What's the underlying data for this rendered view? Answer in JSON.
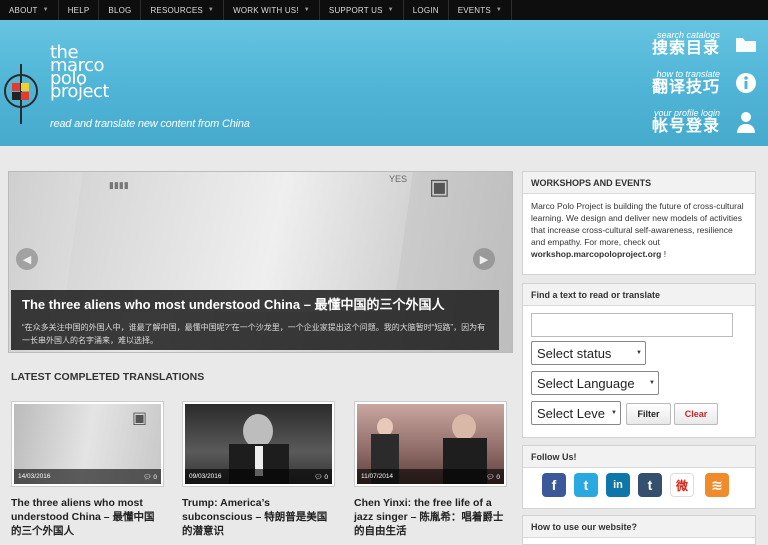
{
  "nav": {
    "items": [
      {
        "label": "ABOUT",
        "caret": true
      },
      {
        "label": "HELP",
        "caret": false
      },
      {
        "label": "BLOG",
        "caret": false
      },
      {
        "label": "RESOURCES",
        "caret": true
      },
      {
        "label": "WORK WITH US!",
        "caret": true
      },
      {
        "label": "SUPPORT US",
        "caret": true
      },
      {
        "label": "LOGIN",
        "caret": false
      },
      {
        "label": "EVENTS",
        "caret": true
      }
    ]
  },
  "banner": {
    "logo_line1": "the",
    "logo_line2": "marco",
    "logo_line3": "polo",
    "logo_line4": "project",
    "tagline": "read and translate new content from China",
    "tools": [
      {
        "en": "search catalogs",
        "zh": "搜索目录",
        "icon": "folder-icon"
      },
      {
        "en": "how to translate",
        "zh": "翻译技巧",
        "icon": "info-icon"
      },
      {
        "en": "your profile login",
        "zh": "帐号登录",
        "icon": "user-icon"
      }
    ]
  },
  "slider": {
    "title": "The three aliens who most understood China – 最懂中国的三个外国人",
    "summary": "“在众多关注中国的外国人中，谁最了解中国，最懂中国呢?”在一个沙龙里，一个企业家提出这个问题。我的大脑暂时“短路”，因为有一长串外国人的名字涌来，难以选择。"
  },
  "translations": {
    "heading": "LATEST COMPLETED TRANSLATIONS",
    "cards": [
      {
        "date": "14/03/2016",
        "comments": "0",
        "title": "The three aliens who most understood China – 最懂中国的三个外国人"
      },
      {
        "date": "09/03/2016",
        "comments": "0",
        "title": "Trump: America’s subconscious – 特朗普是美国的潜意识"
      },
      {
        "date": "11/07/2014",
        "comments": "0",
        "title": "Chen Yinxi: the free life of a jazz singer – 陈胤希：唱着爵士的自由生活"
      }
    ]
  },
  "sidebar": {
    "workshops_heading": "WORKSHOPS AND EVENTS",
    "workshops_text": "Marco Polo Project is building the future of cross-cultural learning. We design and deliver new models of activities that increase cross-cultural self-awareness, resilience and empathy. For more, check out ",
    "workshops_link": "workshop.marcopoloproject.org",
    "workshops_end": " !",
    "find_heading": "Find a text to read or translate",
    "search_value": "",
    "status_select": "Select status",
    "language_select": "Select Language",
    "level_select": "Select Leve",
    "filter_label": "Filter",
    "clear_label": "Clear",
    "follow_heading": "Follow Us!",
    "social": [
      {
        "icon": "facebook-icon",
        "color": "#3b5998",
        "glyph": "f"
      },
      {
        "icon": "twitter-icon",
        "color": "#2aa9e0",
        "glyph": "t"
      },
      {
        "icon": "linkedin-icon",
        "color": "#0e76a8",
        "glyph": "in"
      },
      {
        "icon": "tumblr-icon",
        "color": "#35506e",
        "glyph": "t"
      },
      {
        "icon": "weibo-icon",
        "color": "#ffffff",
        "glyph": "微"
      },
      {
        "icon": "rss-icon",
        "color": "#f08b2c",
        "glyph": "≋"
      }
    ],
    "howto_heading": "How to use our website?"
  }
}
